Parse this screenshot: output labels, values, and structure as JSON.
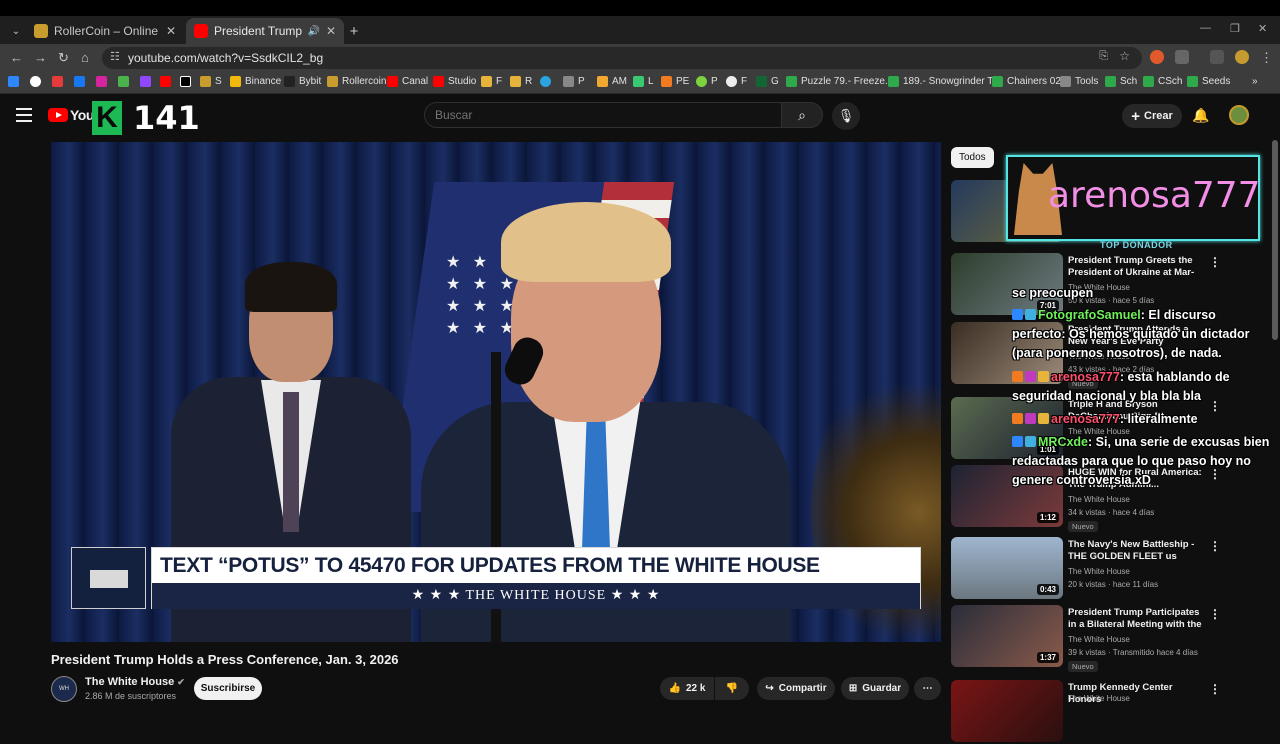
{
  "browser": {
    "tabs": [
      {
        "title": "RollerCoin – Online Bitcoin Mi",
        "active": false
      },
      {
        "title": "President Trump Holds a Pre",
        "active": true
      }
    ],
    "url": "youtube.com/watch?v=SsdkCIL2_bg",
    "bookmarks": [
      "S",
      "Binance",
      "Bybit",
      "Rollercoin",
      "Canal",
      "Studio",
      "F",
      "R",
      "P",
      "AM",
      "L",
      "PE",
      "P",
      "F",
      "G",
      "Puzzle 79.- Freeze...",
      "189.- Snowgrinder T...",
      "Chainers 02",
      "Tools",
      "Sch",
      "CSch",
      "Seeds"
    ]
  },
  "header": {
    "logo_text": "YouTu",
    "overlay_count": "141",
    "overlay_letter": "K",
    "search_placeholder": "Buscar",
    "create_label": "Crear"
  },
  "video": {
    "lower_third_headline": "TEXT “POTUS” TO 45470 FOR UPDATES FROM THE WHITE HOUSE",
    "lower_third_bar": "★ ★ ★   THE WHITE HOUSE   ★ ★ ★",
    "title": "President Trump Holds a Press Conference, Jan. 3, 2026",
    "channel": "The White House",
    "subscribers": "2.86 M de suscriptores",
    "subscribe_label": "Suscribirse",
    "likes": "22 k",
    "share_label": "Compartir",
    "save_label": "Guardar"
  },
  "sidebar": {
    "chip_all": "Todos",
    "items": [
      {
        "title": "President Trump Greets the President of Ukraine at Mar-a-...",
        "channel": "The White House",
        "meta": "50 k vistas · hace 5 días",
        "duration": "7:01",
        "nuevo": "Nuevo"
      },
      {
        "title": "President Trump Attends a New Year's Eve Party",
        "channel": "The White House",
        "meta": "43 k vistas · hace 2 días",
        "duration": "",
        "nuevo": "Nuevo"
      },
      {
        "title": "Triple H and Bryson DeChambeau Sign Et...",
        "channel": "The White House",
        "meta": "",
        "duration": "1:01",
        "nuevo": ""
      },
      {
        "title": "HUGE WIN for Rural America: The Trump Admini...",
        "channel": "The White House",
        "meta": "34 k vistas · hace 4 días",
        "duration": "1:12",
        "nuevo": "Nuevo"
      },
      {
        "title": "The Navy's New Battleship - THE GOLDEN FLEET us",
        "channel": "The White House",
        "meta": "20 k vistas · hace 11 días",
        "duration": "0:43",
        "nuevo": ""
      },
      {
        "title": "President Trump Participates in a Bilateral Meeting with the ...",
        "channel": "The White House",
        "meta": "39 k vistas · Transmitido hace 4 días",
        "duration": "1:37",
        "nuevo": "Nuevo"
      },
      {
        "title": "Trump Kennedy Center Honors",
        "channel": "The White House",
        "meta": "",
        "duration": "",
        "nuevo": ""
      }
    ]
  },
  "overlay": {
    "donor_name": "arenosa777",
    "donor_label": "TOP DONADOR",
    "chat": [
      {
        "user": "",
        "text": "se preocupen"
      },
      {
        "user": "FotografoSamuel",
        "text": ": El discurso perfecto: Os hemos quitado un dictador (para ponernos nosotros), de nada."
      },
      {
        "user": "arenosa777",
        "text": ": esta hablando de seguridad nacional y bla bla bla"
      },
      {
        "user": "arenosa777",
        "text": ": literalmente"
      },
      {
        "user": "MRCxde",
        "text": ": Si, una serie de excusas bien redactadas para que lo que paso hoy no genere controversia xD"
      }
    ]
  },
  "colors": {
    "accent": "#ff0000",
    "donor_border": "#54e4e4",
    "chat_user": "#6ff05b",
    "chat_user_donor": "#ff4f6b"
  }
}
